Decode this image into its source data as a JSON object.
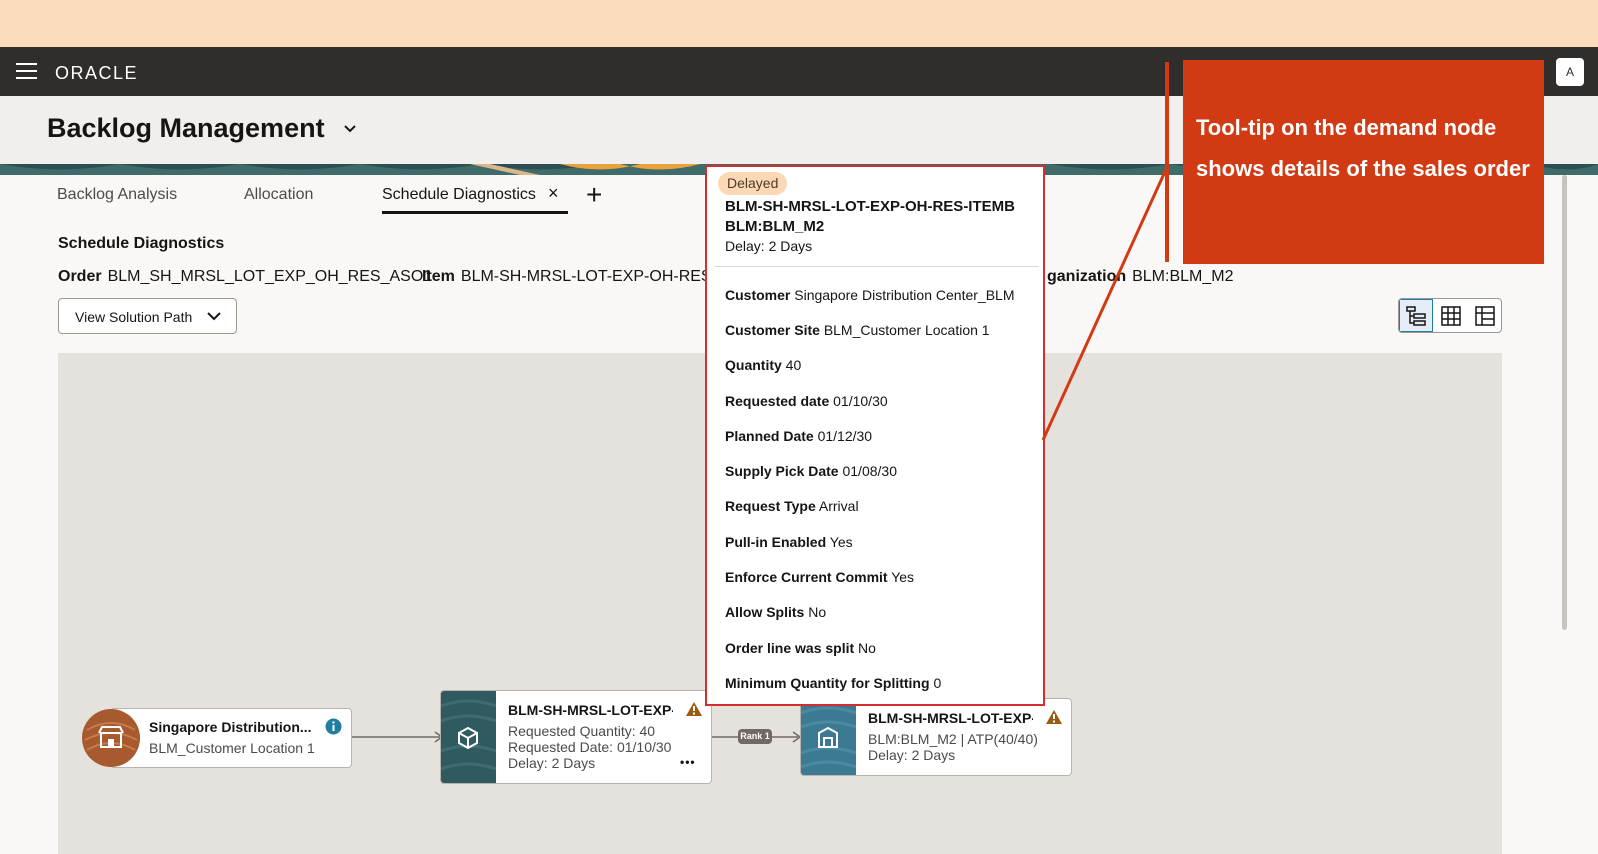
{
  "app": {
    "brand": "ORACLE",
    "avatar_initial": "A",
    "page_title": "Backlog Management"
  },
  "tabs": [
    {
      "label": "Backlog Analysis"
    },
    {
      "label": "Allocation"
    },
    {
      "label": "Schedule Diagnostics",
      "active": true
    }
  ],
  "tab_close": "×",
  "tab_add": "+",
  "section": {
    "title": "Schedule Diagnostics",
    "order_label": "Order",
    "order_value": "BLM_SH_MRSL_LOT_EXP_OH_RES_ASO1",
    "item_label": "Item",
    "item_value": "BLM-SH-MRSL-LOT-EXP-OH-RES",
    "org_label": "ganization",
    "org_value": "BLM:BLM_M2"
  },
  "solution_button": "View Solution Path",
  "view_buttons": [
    "tree-view-icon",
    "grid-view-icon",
    "table-view-icon"
  ],
  "nodes": {
    "customer": {
      "title": "Singapore Distribution...",
      "line1": "BLM_Customer Location 1"
    },
    "demand": {
      "title": "BLM-SH-MRSL-LOT-EXP-",
      "line1": "Requested Quantity: 40",
      "line2": "Requested Date: 01/10/30",
      "line3": "Delay: 2 Days",
      "more": "•••"
    },
    "rank_label": "Rank 1",
    "supply": {
      "title": "BLM-SH-MRSL-LOT-EXP-",
      "line1": "BLM:BLM_M2 | ATP(40/40)",
      "line2": "Delay: 2 Days"
    }
  },
  "tooltip": {
    "badge": "Delayed",
    "title": "BLM-SH-MRSL-LOT-EXP-OH-RES-ITEMB BLM:BLM_M2",
    "delay": "Delay: 2 Days",
    "rows": [
      {
        "label": "Customer",
        "value": "Singapore Distribution Center_BLM"
      },
      {
        "label": "Customer Site",
        "value": "BLM_Customer Location 1"
      },
      {
        "label": "Quantity",
        "value": "40"
      },
      {
        "label": "Requested date",
        "value": "01/10/30"
      },
      {
        "label": "Planned Date",
        "value": "01/12/30"
      },
      {
        "label": "Supply Pick Date",
        "value": "01/08/30"
      },
      {
        "label": "Request Type",
        "value": "Arrival"
      },
      {
        "label": "Pull-in Enabled",
        "value": "Yes"
      },
      {
        "label": "Enforce Current Commit",
        "value": "Yes"
      },
      {
        "label": "Allow Splits",
        "value": "No"
      },
      {
        "label": "Order line was split",
        "value": "No"
      },
      {
        "label": "Minimum Quantity for Splitting",
        "value": "0"
      }
    ]
  },
  "callout": {
    "text": "Tool-tip on the demand node shows details of the sales order"
  },
  "colors": {
    "banner": "#fadcbc",
    "appbar": "#312d2a",
    "callout": "#d13a13",
    "tooltip_border": "#d32f2f",
    "badge": "#fbd9b5",
    "node_tile": "#2f5a5f",
    "customer_circle": "#a65a2e",
    "info": "#227e9e",
    "warning": "#9a5a10"
  }
}
